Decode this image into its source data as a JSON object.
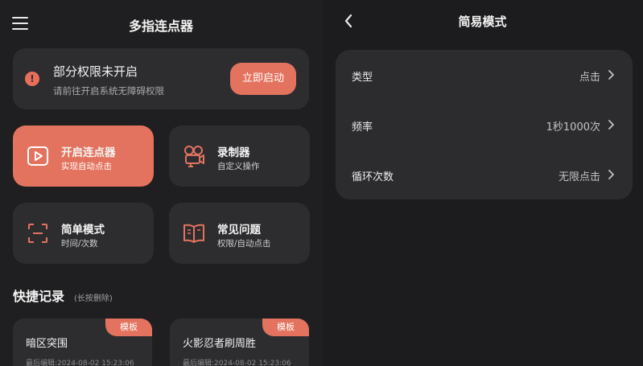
{
  "left": {
    "header": {
      "title": "多指连点器",
      "menu_icon": "hamburger-menu-icon"
    },
    "permission": {
      "title": "部分权限未开启",
      "subtitle": "请前往开启系统无障碍权限",
      "button": "立即启动",
      "icon": "warning-icon",
      "icon_glyph": "!"
    },
    "tiles": {
      "start": {
        "title": "开启连点器",
        "subtitle": "实现自动点击",
        "icon": "play-icon"
      },
      "record": {
        "title": "录制器",
        "subtitle": "自定义操作",
        "icon": "video-camera-icon"
      },
      "simple": {
        "title": "简单模式",
        "subtitle": "时间/次数",
        "icon": "scan-frame-icon"
      },
      "faq": {
        "title": "常见问题",
        "subtitle": "权限/自动点击",
        "icon": "book-icon"
      }
    },
    "shortcuts": {
      "title": "快捷记录",
      "hint": "(长按删除)",
      "records": [
        {
          "name": "暗区突围",
          "badge": "模板",
          "time": "最后编辑:2024-08-02 15:23:06"
        },
        {
          "name": "火影忍者刷周胜",
          "badge": "模板",
          "time": "最后编辑:2024-08-02 15:23:06"
        }
      ]
    }
  },
  "right": {
    "header": {
      "title": "简易模式",
      "back_icon": "back-chevron-icon"
    },
    "settings": [
      {
        "label": "类型",
        "value": "点击"
      },
      {
        "label": "频率",
        "value": "1秒1000次"
      },
      {
        "label": "循环次数",
        "value": "无限点击"
      }
    ]
  },
  "colors": {
    "accent": "#e3735e",
    "background": "#1f1f21",
    "card": "#2d2d30",
    "text_primary": "#f2f2f2",
    "text_secondary": "#a9a9ad"
  }
}
